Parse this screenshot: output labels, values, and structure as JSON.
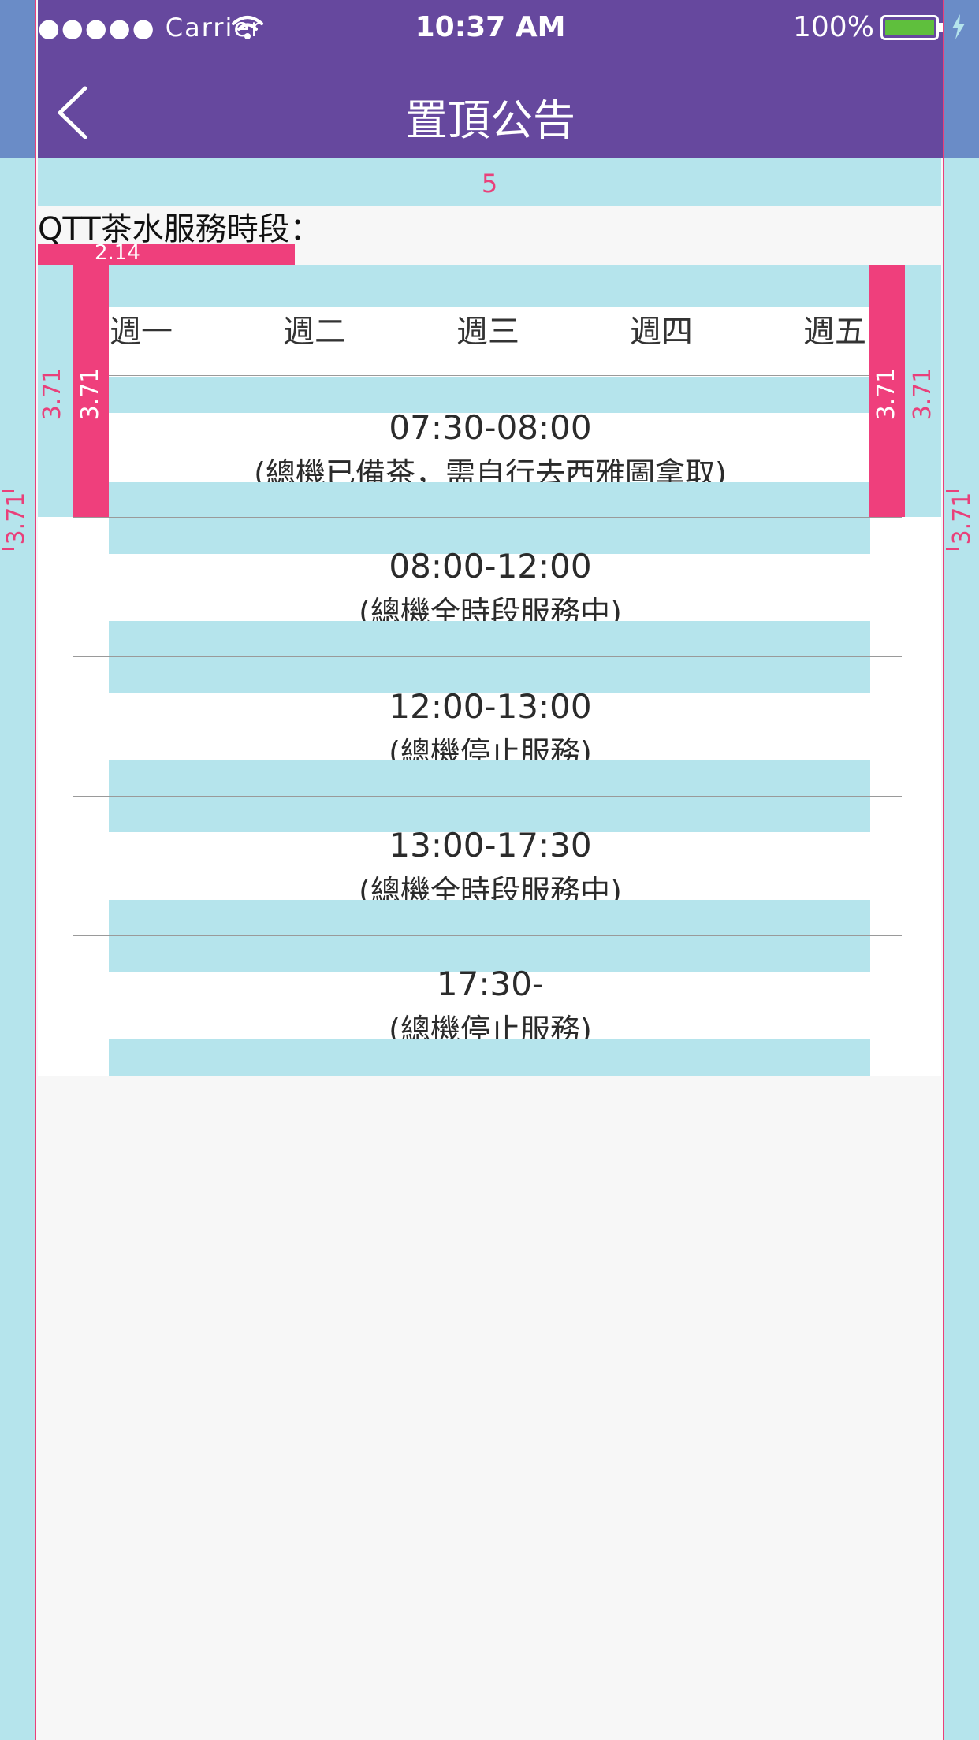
{
  "status_bar": {
    "carrier": "●●●●● Carrier",
    "time": "10:37 AM",
    "battery": "100%",
    "battery_level": 1.0
  },
  "nav": {
    "title": "置頂公告",
    "back_icon": "chevron-left-icon"
  },
  "annotations": {
    "top_spacing": "5",
    "title_width": "2.14",
    "side_spacing": "3.71"
  },
  "section": {
    "title": "QTT茶水服務時段："
  },
  "days": [
    "週一",
    "週二",
    "週三",
    "週四",
    "週五"
  ],
  "slots": [
    {
      "time": "07:30-08:00",
      "note": "(總機已備茶，需自行去西雅圖拿取)"
    },
    {
      "time": "08:00-12:00",
      "note": "(總機全時段服務中)"
    },
    {
      "time": "12:00-13:00",
      "note": "(總機停止服務)"
    },
    {
      "time": "13:00-17:30",
      "note": "(總機全時段服務中)"
    },
    {
      "time": "17:30-",
      "note": "(總機停止服務)"
    }
  ],
  "colors": {
    "nav_bg": "#66489e",
    "guide_band": "#b5e4ec",
    "guide_marker": "#ef3f7c"
  }
}
